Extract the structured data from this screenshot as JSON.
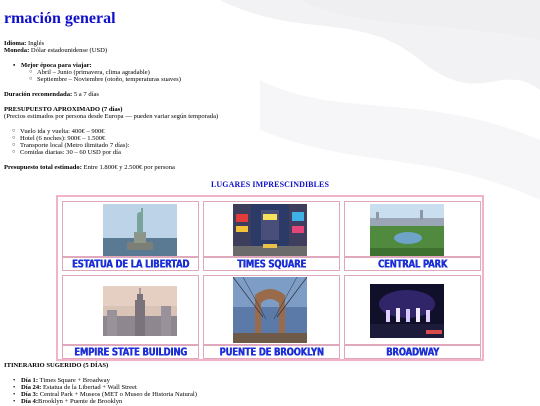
{
  "title": "rmación general",
  "info": {
    "language_label": "Idioma:",
    "language_value": " Inglés",
    "currency_label": "Moneda:",
    "currency_value": " Dólar estadounidense (USD)"
  },
  "best_time": {
    "label": "Mejor época para viajar:",
    "items": [
      "Abril – Junio (primavera, clima agradable)",
      "Septiembre – Noviembre (otoño, temperaturas suaves)"
    ]
  },
  "duration": {
    "label": "Duración recomendada:",
    "value": " 5 a 7 días"
  },
  "budget": {
    "title": "PRESUPUESTO APROXIMADO (7 días)",
    "subtitle": "(Precios estimados por persona desde Europa — pueden variar según temporada)",
    "items": [
      "Vuelo ida y vuelta: 400€ – 900€",
      "Hotel (6 noches): 900€ – 1.500€",
      "Transporte local (Metro ilimitado 7 días):",
      "Comidas diarias: 30 – 60 USD por día"
    ],
    "total_label": "Presupuesto total estimado:",
    "total_value": " Entre 1.800€ y 2.500€ por persona"
  },
  "places": {
    "title": "LUGARES IMPRESCINDIBLES",
    "items": [
      {
        "caption": "ESTATUA DE LA LIBERTAD",
        "icon": "statue-of-liberty-photo"
      },
      {
        "caption": "TIMES SQUARE",
        "icon": "times-square-photo"
      },
      {
        "caption": "CENTRAL PARK",
        "icon": "central-park-photo"
      },
      {
        "caption": "EMPIRE STATE BUILDING",
        "icon": "empire-state-photo"
      },
      {
        "caption": "PUENTE DE BROOKLYN",
        "icon": "brooklyn-bridge-photo"
      },
      {
        "caption": "BROADWAY",
        "icon": "broadway-photo"
      }
    ]
  },
  "itinerary": {
    "title": "ITINERARIO SUGERIDO (5 DÍAS)",
    "items": [
      {
        "day": "Día 1:",
        "text": " Times Square + Broadway"
      },
      {
        "day": "Día 24:",
        "text": " Estatua de la Libertad + Wall Street"
      },
      {
        "day": "Día 3:",
        "text": " Central Park + Museos (MET o Museo de Historia Natural)"
      },
      {
        "day": "Día 4:",
        "text": "Brooklyn + Puente de Brooklyn"
      }
    ]
  },
  "colors": {
    "accent": "#1010c8",
    "caption": "#1a2fe0",
    "border": "#f0b3c8"
  }
}
